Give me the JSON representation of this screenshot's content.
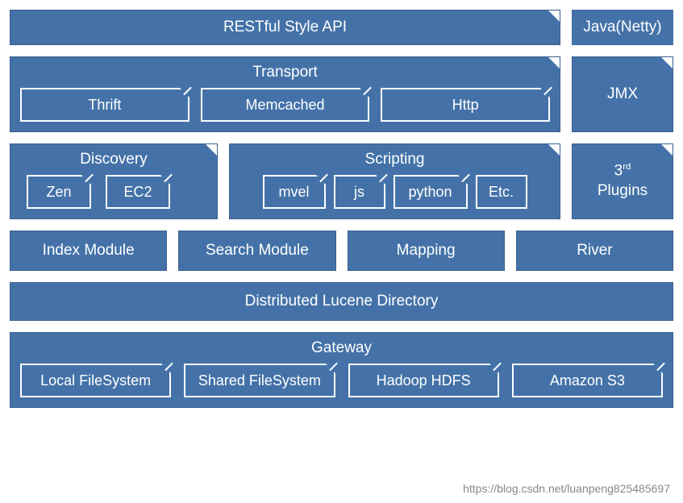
{
  "colors": {
    "primary": "#4472a8",
    "border": "#3a5f8e",
    "text": "#ffffff"
  },
  "row1": {
    "api": "RESTful Style API",
    "java": "Java(Netty)"
  },
  "row2": {
    "transport": {
      "title": "Transport",
      "items": [
        "Thrift",
        "Memcached",
        "Http"
      ]
    },
    "jmx": "JMX"
  },
  "row3": {
    "discovery": {
      "title": "Discovery",
      "items": [
        "Zen",
        "EC2"
      ]
    },
    "scripting": {
      "title": "Scripting",
      "items": [
        "mvel",
        "js",
        "python",
        "Etc."
      ]
    },
    "plugins_prefix": "3",
    "plugins_sup": "rd",
    "plugins_line2": "Plugins"
  },
  "row4": {
    "items": [
      "Index Module",
      "Search Module",
      "Mapping",
      "River"
    ]
  },
  "row5": "Distributed Lucene Directory",
  "row6": {
    "gateway": {
      "title": "Gateway",
      "items": [
        "Local FileSystem",
        "Shared FileSystem",
        "Hadoop HDFS",
        "Amazon S3"
      ]
    }
  },
  "watermark": "https://blog.csdn.net/luanpeng825485697"
}
